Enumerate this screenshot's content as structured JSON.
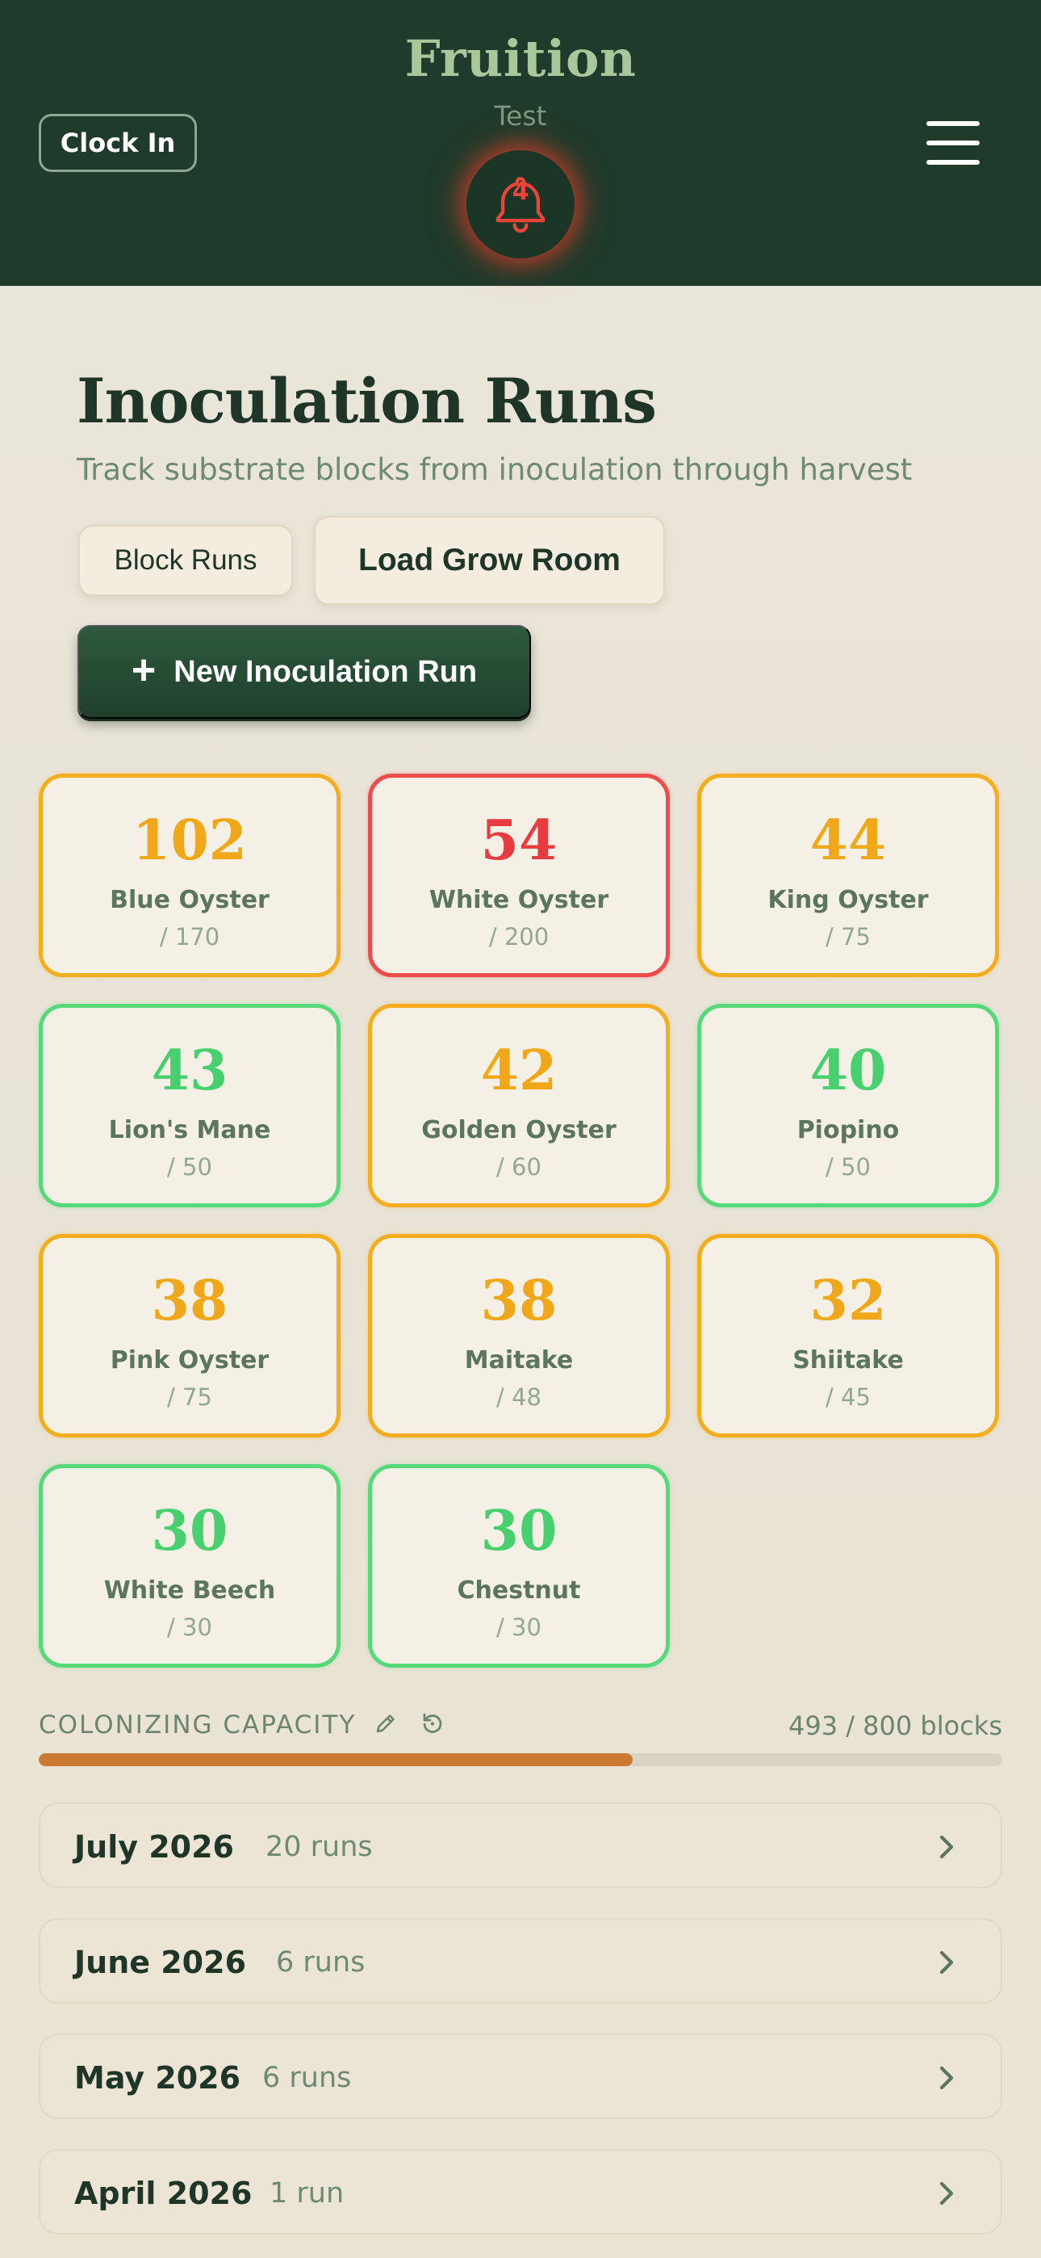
{
  "header": {
    "app_title": "Fruition",
    "user_label": "Test",
    "clock_button": "Clock In",
    "notification_count": "4",
    "menu_icon": "hamburger-menu-icon",
    "bell_icon": "bell-icon",
    "alert_color": "#e8463a"
  },
  "page": {
    "title": "Inoculation Runs",
    "subtitle": "Track substrate blocks from inoculation through harvest",
    "block_runs_label": "Block Runs",
    "load_grow_room_label": "Load Grow Room",
    "new_run_label": "New Inoculation Run",
    "new_run_icon": "plus-icon"
  },
  "status_colors": {
    "warn": "#f4ad1e",
    "critical": "#ee4b4b",
    "ok": "#57d97a"
  },
  "varieties": [
    {
      "count": "102",
      "name": "Blue Oyster",
      "capacity": "/ 170",
      "status": "warn"
    },
    {
      "count": "54",
      "name": "White Oyster",
      "capacity": "/ 200",
      "status": "critical"
    },
    {
      "count": "44",
      "name": "King Oyster",
      "capacity": "/ 75",
      "status": "warn"
    },
    {
      "count": "43",
      "name": "Lion's Mane",
      "capacity": "/ 50",
      "status": "ok"
    },
    {
      "count": "42",
      "name": "Golden Oyster",
      "capacity": "/ 60",
      "status": "warn"
    },
    {
      "count": "40",
      "name": "Piopino",
      "capacity": "/ 50",
      "status": "ok"
    },
    {
      "count": "38",
      "name": "Pink Oyster",
      "capacity": "/ 75",
      "status": "warn"
    },
    {
      "count": "38",
      "name": "Maitake",
      "capacity": "/ 48",
      "status": "warn"
    },
    {
      "count": "32",
      "name": "Shiitake",
      "capacity": "/ 45",
      "status": "warn"
    },
    {
      "count": "30",
      "name": "White Beech",
      "capacity": "/ 30",
      "status": "ok"
    },
    {
      "count": "30",
      "name": "Chestnut",
      "capacity": "/ 30",
      "status": "ok"
    }
  ],
  "capacity": {
    "label": "COLONIZING CAPACITY",
    "value_text": "493 / 800 blocks",
    "used": 493,
    "total": 800,
    "edit_icon": "pencil-icon",
    "reset_icon": "reset-icon",
    "bar_color": "#cc7a33"
  },
  "months": [
    {
      "title": "July 2026",
      "runs": "20 runs"
    },
    {
      "title": "June 2026",
      "runs": "6 runs"
    },
    {
      "title": "May 2026",
      "runs": "6 runs"
    },
    {
      "title": "April 2026",
      "runs": "1 run"
    }
  ]
}
